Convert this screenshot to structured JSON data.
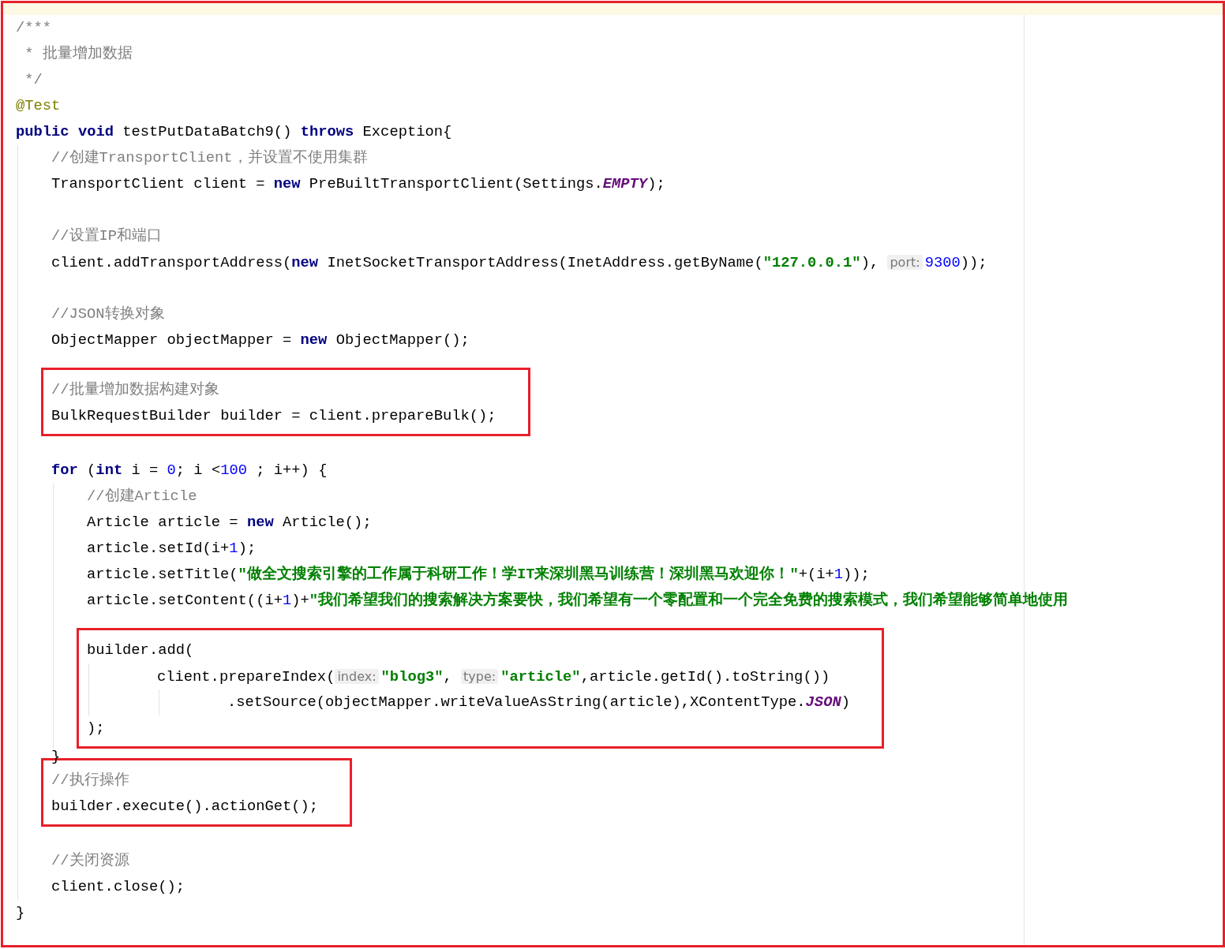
{
  "editor": {
    "lines": [
      {
        "kind": "line",
        "tokens": [
          {
            "kind": "comment",
            "text": "/***"
          }
        ]
      },
      {
        "kind": "line",
        "tokens": [
          {
            "kind": "comment",
            "text": " * 批量增加数据"
          }
        ]
      },
      {
        "kind": "line",
        "tokens": [
          {
            "kind": "comment",
            "text": " */"
          }
        ]
      },
      {
        "kind": "line",
        "tokens": [
          {
            "kind": "annotation",
            "text": "@Test"
          }
        ]
      },
      {
        "kind": "line",
        "tokens": [
          {
            "kind": "keyword",
            "text": "public void"
          },
          {
            "kind": "plain",
            "text": " testPutDataBatch9() "
          },
          {
            "kind": "keyword",
            "text": "throws"
          },
          {
            "kind": "plain",
            "text": " Exception{"
          }
        ],
        "children": [
          {
            "kind": "line",
            "tokens": [
              {
                "kind": "comment",
                "text": "//创建TransportClient，并设置不使用集群"
              }
            ]
          },
          {
            "kind": "line",
            "tokens": [
              {
                "kind": "plain",
                "text": "TransportClient client = "
              },
              {
                "kind": "keyword",
                "text": "new"
              },
              {
                "kind": "plain",
                "text": " PreBuiltTransportClient(Settings."
              },
              {
                "kind": "constant",
                "text": "EMPTY"
              },
              {
                "kind": "plain",
                "text": ");"
              }
            ]
          },
          {
            "kind": "blank"
          },
          {
            "kind": "line",
            "tokens": [
              {
                "kind": "comment",
                "text": "//设置IP和端口"
              }
            ]
          },
          {
            "kind": "line",
            "tokens": [
              {
                "kind": "plain",
                "text": "client.addTransportAddress("
              },
              {
                "kind": "keyword",
                "text": "new"
              },
              {
                "kind": "plain",
                "text": " InetSocketTransportAddress(InetAddress.getByName("
              },
              {
                "kind": "string",
                "text": "\"127.0.0.1\""
              },
              {
                "kind": "plain",
                "text": "), "
              },
              {
                "kind": "hint",
                "text": "port:"
              },
              {
                "kind": "number",
                "text": "9300"
              },
              {
                "kind": "plain",
                "text": "));"
              }
            ]
          },
          {
            "kind": "blank"
          },
          {
            "kind": "line",
            "tokens": [
              {
                "kind": "comment",
                "text": "//JSON转换对象"
              }
            ]
          },
          {
            "kind": "line",
            "tokens": [
              {
                "kind": "plain",
                "text": "ObjectMapper objectMapper = "
              },
              {
                "kind": "keyword",
                "text": "new"
              },
              {
                "kind": "plain",
                "text": " ObjectMapper();"
              }
            ]
          },
          {
            "kind": "blank"
          },
          {
            "kind": "boxed",
            "items": [
              {
                "kind": "line",
                "tokens": [
                  {
                    "kind": "comment",
                    "text": "//批量增加数据构建对象"
                  }
                ]
              },
              {
                "kind": "line",
                "tokens": [
                  {
                    "kind": "plain",
                    "text": "BulkRequestBuilder builder = client.prepareBulk();"
                  }
                ]
              }
            ]
          },
          {
            "kind": "blank"
          },
          {
            "kind": "line",
            "tokens": [
              {
                "kind": "keyword",
                "text": "for"
              },
              {
                "kind": "plain",
                "text": " ("
              },
              {
                "kind": "keyword",
                "text": "int"
              },
              {
                "kind": "plain",
                "text": " i = "
              },
              {
                "kind": "number",
                "text": "0"
              },
              {
                "kind": "plain",
                "text": "; i <"
              },
              {
                "kind": "number",
                "text": "100"
              },
              {
                "kind": "plain",
                "text": " ; i++) {"
              }
            ],
            "children": [
              {
                "kind": "line",
                "tokens": [
                  {
                    "kind": "comment",
                    "text": "//创建Article"
                  }
                ]
              },
              {
                "kind": "line",
                "tokens": [
                  {
                    "kind": "plain",
                    "text": "Article article = "
                  },
                  {
                    "kind": "keyword",
                    "text": "new"
                  },
                  {
                    "kind": "plain",
                    "text": " Article();"
                  }
                ]
              },
              {
                "kind": "line",
                "tokens": [
                  {
                    "kind": "plain",
                    "text": "article.setId(i+"
                  },
                  {
                    "kind": "number",
                    "text": "1"
                  },
                  {
                    "kind": "plain",
                    "text": ");"
                  }
                ]
              },
              {
                "kind": "line",
                "tokens": [
                  {
                    "kind": "plain",
                    "text": "article.setTitle("
                  },
                  {
                    "kind": "string",
                    "text": "\"做全文搜索引擎的工作属于科研工作！学IT来深圳黑马训练营！深圳黑马欢迎你！\""
                  },
                  {
                    "kind": "plain",
                    "text": "+(i+"
                  },
                  {
                    "kind": "number",
                    "text": "1"
                  },
                  {
                    "kind": "plain",
                    "text": "));"
                  }
                ]
              },
              {
                "kind": "line",
                "tokens": [
                  {
                    "kind": "plain",
                    "text": "article.setContent((i+"
                  },
                  {
                    "kind": "number",
                    "text": "1"
                  },
                  {
                    "kind": "plain",
                    "text": ")+"
                  },
                  {
                    "kind": "string",
                    "text": "\"我们希望我们的搜索解决方案要快，我们希望有一个零配置和一个完全免费的搜索模式，我们希望能够简单地使用"
                  }
                ]
              },
              {
                "kind": "blank"
              },
              {
                "kind": "boxed",
                "items": [
                  {
                    "kind": "wrapped",
                    "tokens": [
                      {
                        "kind": "plain",
                        "text": "builder.add("
                      }
                    ],
                    "children": [
                      {
                        "kind": "wrapped",
                        "tokens": [
                          {
                            "kind": "plain",
                            "text": "client.prepareIndex("
                          },
                          {
                            "kind": "hint",
                            "text": "index:"
                          },
                          {
                            "kind": "string",
                            "text": "\"blog3\""
                          },
                          {
                            "kind": "plain",
                            "text": ", "
                          },
                          {
                            "kind": "hint",
                            "text": "type:"
                          },
                          {
                            "kind": "string",
                            "text": "\"article\""
                          },
                          {
                            "kind": "plain",
                            "text": ",article.getId().toString())"
                          }
                        ],
                        "children": [
                          {
                            "kind": "line",
                            "tokens": [
                              {
                                "kind": "plain",
                                "text": ".setSource(objectMapper.writeValueAsString(article),XContentType."
                              },
                              {
                                "kind": "constant",
                                "text": "JSON"
                              },
                              {
                                "kind": "plain",
                                "text": ")"
                              }
                            ]
                          }
                        ]
                      }
                    ]
                  },
                  {
                    "kind": "line",
                    "tokens": [
                      {
                        "kind": "plain",
                        "text": ");"
                      }
                    ]
                  }
                ]
              }
            ]
          },
          {
            "kind": "line",
            "tokens": [
              {
                "kind": "plain",
                "text": "}"
              }
            ]
          },
          {
            "kind": "boxed",
            "items": [
              {
                "kind": "line",
                "tokens": [
                  {
                    "kind": "comment",
                    "text": "//执行操作"
                  }
                ]
              },
              {
                "kind": "line",
                "tokens": [
                  {
                    "kind": "plain",
                    "text": "builder.execute().actionGet();"
                  }
                ]
              }
            ]
          },
          {
            "kind": "blank"
          },
          {
            "kind": "line",
            "tokens": [
              {
                "kind": "comment",
                "text": "//关闭资源"
              }
            ]
          },
          {
            "kind": "line",
            "tokens": [
              {
                "kind": "plain",
                "text": "client.close();"
              }
            ]
          }
        ]
      },
      {
        "kind": "line",
        "tokens": [
          {
            "kind": "plain",
            "text": "}"
          }
        ]
      }
    ]
  }
}
